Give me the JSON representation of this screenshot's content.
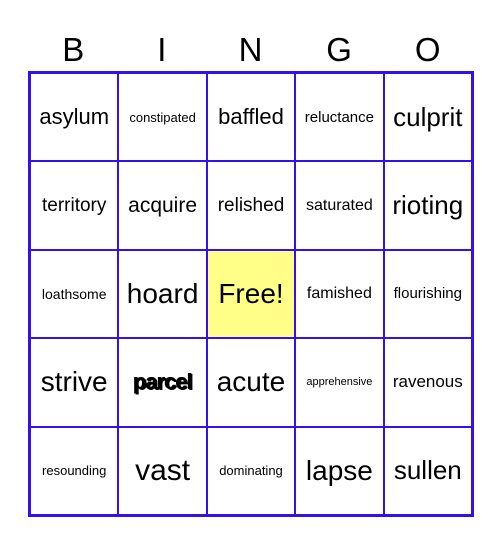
{
  "header": [
    "B",
    "I",
    "N",
    "G",
    "O"
  ],
  "accent_color": "#3311ee",
  "free_color": "#ffff88",
  "cells": [
    {
      "text": "asylum",
      "size": 22
    },
    {
      "text": "constipated",
      "size": 13
    },
    {
      "text": "baffled",
      "size": 22
    },
    {
      "text": "reluctance",
      "size": 15
    },
    {
      "text": "culprit",
      "size": 26
    },
    {
      "text": "territory",
      "size": 19
    },
    {
      "text": "acquire",
      "size": 21
    },
    {
      "text": "relished",
      "size": 19
    },
    {
      "text": "saturated",
      "size": 16
    },
    {
      "text": "rioting",
      "size": 26
    },
    {
      "text": "loathsome",
      "size": 14
    },
    {
      "text": "hoard",
      "size": 28
    },
    {
      "text": "Free!",
      "size": 28,
      "free": true
    },
    {
      "text": "famished",
      "size": 16
    },
    {
      "text": "flourishing",
      "size": 15
    },
    {
      "text": "strive",
      "size": 28
    },
    {
      "text": "parcel",
      "size": 22,
      "bold": true
    },
    {
      "text": "acute",
      "size": 28
    },
    {
      "text": "apprehensive",
      "size": 11
    },
    {
      "text": "ravenous",
      "size": 17
    },
    {
      "text": "resounding",
      "size": 13
    },
    {
      "text": "vast",
      "size": 30
    },
    {
      "text": "dominating",
      "size": 13
    },
    {
      "text": "lapse",
      "size": 28
    },
    {
      "text": "sullen",
      "size": 26
    }
  ]
}
